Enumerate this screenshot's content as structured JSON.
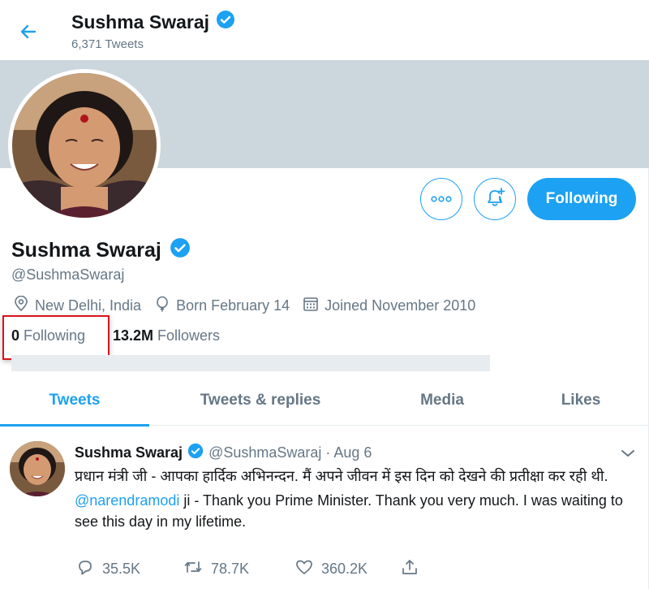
{
  "header": {
    "name": "Sushma Swaraj",
    "tweet_count": "6,371 Tweets"
  },
  "profile": {
    "name": "Sushma Swaraj",
    "handle": "@SushmaSwaraj",
    "location": "New Delhi, India",
    "birthday": "Born February 14",
    "joined": "Joined November 2010",
    "following_count": "0",
    "following_label": "Following",
    "followers_count": "13.2M",
    "followers_label": "Followers",
    "follow_button": "Following"
  },
  "tabs": [
    {
      "label": "Tweets",
      "active": true
    },
    {
      "label": "Tweets & replies",
      "active": false
    },
    {
      "label": "Media",
      "active": false
    },
    {
      "label": "Likes",
      "active": false
    }
  ],
  "tweet": {
    "name": "Sushma Swaraj",
    "handle_date": "@SushmaSwaraj · Aug 6",
    "hindi_text": "प्रधान मंत्री जी - आपका हार्दिक अभिनन्दन. मैं अपने जीवन में इस दिन को देखने की प्रतीक्षा कर रही थी.",
    "mention": "@narendramodi",
    "english_text": " ji - Thank you Prime Minister. Thank you very much. I was waiting to see this day in my lifetime.",
    "replies": "35.5K",
    "retweets": "78.7K",
    "likes": "360.2K"
  },
  "colors": {
    "accent": "#1da1f2",
    "secondary_text": "#657786",
    "banner": "#ccd6dd",
    "highlight": "#d9141c"
  }
}
